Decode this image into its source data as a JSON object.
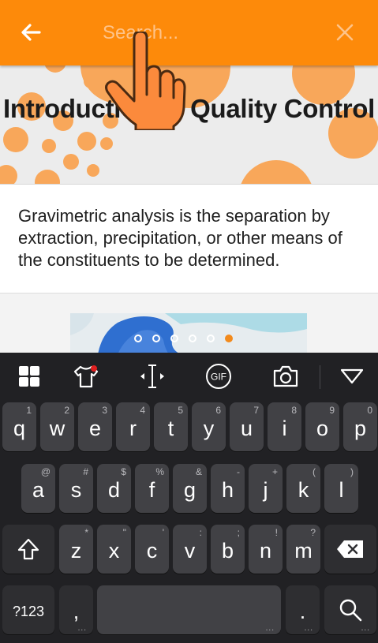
{
  "search": {
    "placeholder": "Search..."
  },
  "banner": {
    "title": "Introduction to Quality Control"
  },
  "article": {
    "text": "Gravimetric analysis is the separation by extraction, precipitation, or other means of the constituents to be determined."
  },
  "pager": {
    "count": 6,
    "active_index": 5
  },
  "colors": {
    "accent": "#fd8a0a",
    "keyboard_bg": "#212124",
    "key_bg": "#414145"
  },
  "keyboard": {
    "toolbar": [
      "apps-icon",
      "theme-shirt-icon",
      "cursor-icon",
      "gif-icon",
      "camera-icon",
      "collapse-icon"
    ],
    "gif_label": "GIF",
    "rows": [
      [
        {
          "k": "q",
          "h": "1"
        },
        {
          "k": "w",
          "h": "2"
        },
        {
          "k": "e",
          "h": "3"
        },
        {
          "k": "r",
          "h": "4"
        },
        {
          "k": "t",
          "h": "5"
        },
        {
          "k": "y",
          "h": "6"
        },
        {
          "k": "u",
          "h": "7"
        },
        {
          "k": "i",
          "h": "8"
        },
        {
          "k": "o",
          "h": "9"
        },
        {
          "k": "p",
          "h": "0"
        }
      ],
      [
        {
          "k": "a",
          "h": "@"
        },
        {
          "k": "s",
          "h": "#"
        },
        {
          "k": "d",
          "h": "$"
        },
        {
          "k": "f",
          "h": "%"
        },
        {
          "k": "g",
          "h": "&"
        },
        {
          "k": "h",
          "h": "-"
        },
        {
          "k": "j",
          "h": "+"
        },
        {
          "k": "k",
          "h": "("
        },
        {
          "k": "l",
          "h": ")"
        }
      ],
      [
        {
          "k": "z",
          "h": "*"
        },
        {
          "k": "x",
          "h": "\""
        },
        {
          "k": "c",
          "h": "'"
        },
        {
          "k": "v",
          "h": ":"
        },
        {
          "k": "b",
          "h": ";"
        },
        {
          "k": "n",
          "h": "!"
        },
        {
          "k": "m",
          "h": "?"
        }
      ]
    ],
    "symbols_label": "?123",
    "comma_label": ",",
    "period_label": ".",
    "ellipsis": "..."
  }
}
